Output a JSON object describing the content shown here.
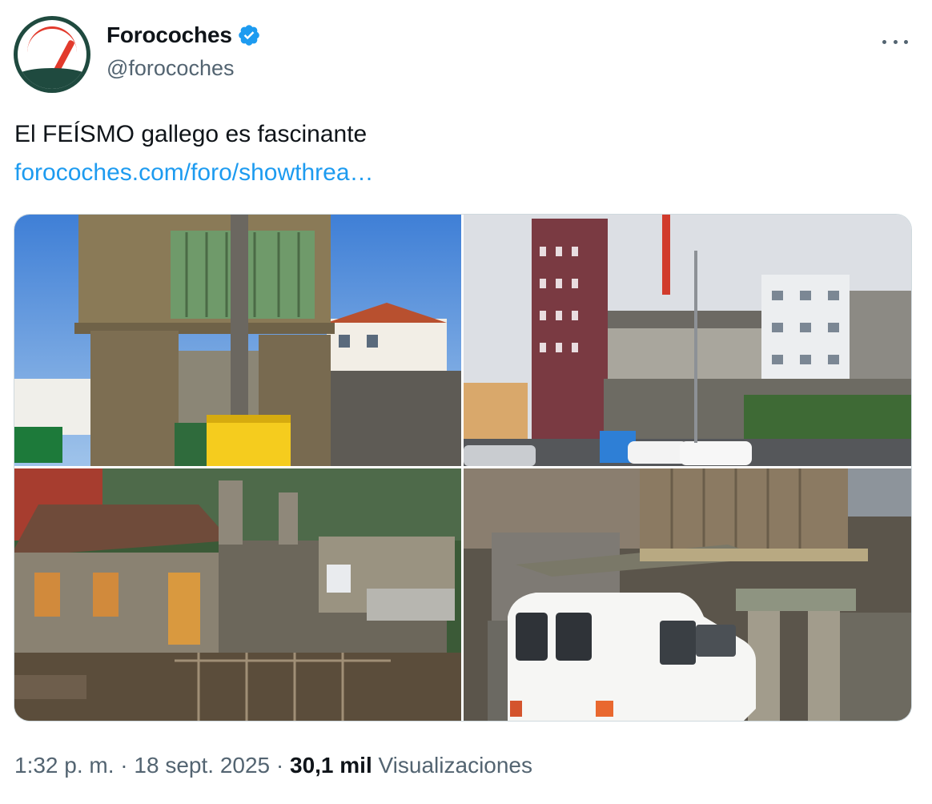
{
  "tweet": {
    "author": {
      "display_name": "Forocoches",
      "handle": "@forocoches",
      "verified": true,
      "avatar_icon": "forocoches-speedometer-logo"
    },
    "text": "El FEÍSMO gallego es fascinante",
    "link": "forocoches.com/foro/showthrea…",
    "media": [
      {
        "icon": "photo-horreo-stone-granary"
      },
      {
        "icon": "photo-narrow-brick-building"
      },
      {
        "icon": "photo-old-stone-houses"
      },
      {
        "icon": "photo-white-van-under-horreo"
      }
    ],
    "meta": {
      "time": "1:32 p. m.",
      "sep1": " · ",
      "date": "18 sept. 2025",
      "sep2": " · ",
      "views_count": "30,1 mil",
      "views_label": "Visualizaciones"
    }
  },
  "colors": {
    "link": "#1d9bf0",
    "verified": "#1d9bf0",
    "secondary_text": "#536471",
    "primary_text": "#0f1419",
    "avatar_green": "#1f4a3f",
    "avatar_red": "#e23a2c"
  }
}
